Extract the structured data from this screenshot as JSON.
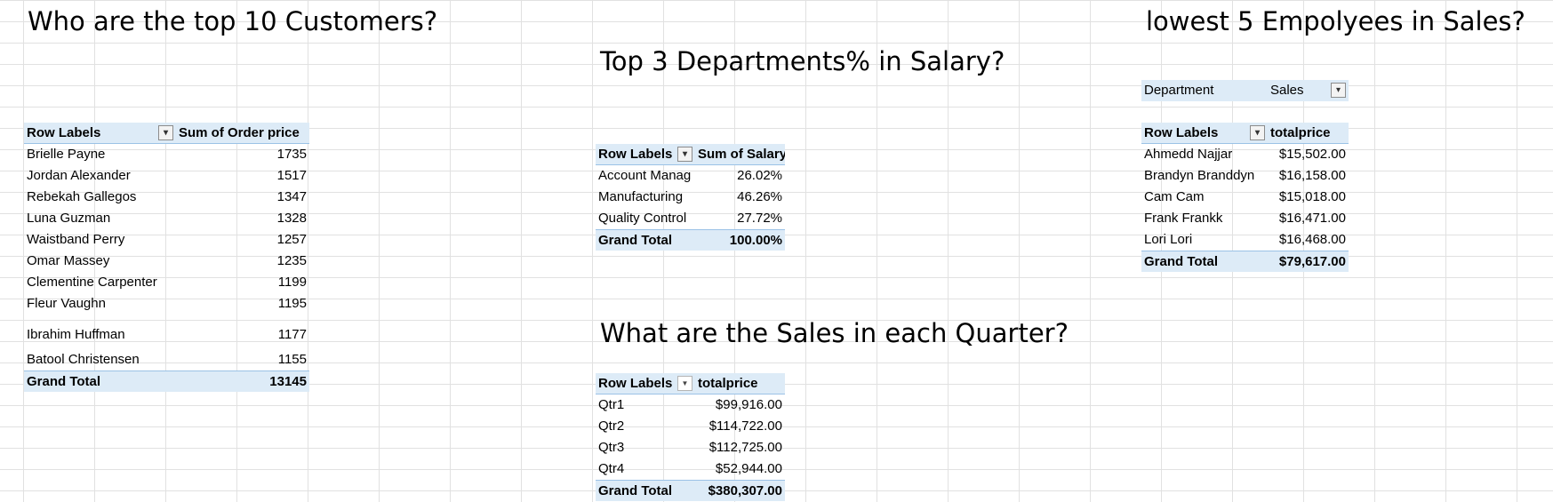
{
  "titles": {
    "top_customers": "Who are the top 10 Customers?",
    "top_departments": "Top 3 Departments% in Salary?",
    "lowest_employees": "lowest 5 Empolyees in Sales?",
    "quarter_sales": "What are the Sales in each Quarter?"
  },
  "customers_pivot": {
    "headers": [
      "Row Labels",
      "Sum of Order price"
    ],
    "rows": [
      {
        "label": "Brielle Payne",
        "value": "1735"
      },
      {
        "label": "Jordan Alexander",
        "value": "1517"
      },
      {
        "label": "Rebekah Gallegos",
        "value": "1347"
      },
      {
        "label": "Luna Guzman",
        "value": "1328"
      },
      {
        "label": "Waistband Perry",
        "value": "1257"
      },
      {
        "label": "Omar Massey",
        "value": "1235"
      },
      {
        "label": "Clementine Carpenter",
        "value": "1199"
      },
      {
        "label": "Fleur Vaughn",
        "value": "1195"
      },
      {
        "label": "Ibrahim Huffman",
        "value": "1177"
      },
      {
        "label": "Batool Christensen",
        "value": "1155"
      }
    ],
    "total": {
      "label": "Grand Total",
      "value": "13145"
    }
  },
  "departments_pivot": {
    "headers": [
      "Row Labels",
      "Sum of Salary"
    ],
    "rows": [
      {
        "label": "Account Manag",
        "value": "26.02%"
      },
      {
        "label": "Manufacturing",
        "value": "46.26%"
      },
      {
        "label": "Quality Control",
        "value": "27.72%"
      }
    ],
    "total": {
      "label": "Grand Total",
      "value": "100.00%"
    }
  },
  "employees_pivot": {
    "filter": {
      "field": "Department",
      "value": "Sales"
    },
    "headers": [
      "Row Labels",
      "totalprice"
    ],
    "rows": [
      {
        "label": "Ahmedd Najjar",
        "value": "$15,502.00"
      },
      {
        "label": "Brandyn Branddyn",
        "value": "$16,158.00"
      },
      {
        "label": "Cam Cam",
        "value": "$15,018.00"
      },
      {
        "label": "Frank Frankk",
        "value": "$16,471.00"
      },
      {
        "label": "Lori Lori",
        "value": "$16,468.00"
      }
    ],
    "total": {
      "label": "Grand Total",
      "value": "$79,617.00"
    }
  },
  "quarters_pivot": {
    "headers": [
      "Row Labels",
      "totalprice"
    ],
    "rows": [
      {
        "label": "Qtr1",
        "value": "$99,916.00"
      },
      {
        "label": "Qtr2",
        "value": "$114,722.00"
      },
      {
        "label": "Qtr3",
        "value": "$112,725.00"
      },
      {
        "label": "Qtr4",
        "value": "$52,944.00"
      }
    ],
    "total": {
      "label": "Grand Total",
      "value": "$380,307.00"
    }
  },
  "icons": {
    "filter": "funnel-icon",
    "dropdown": "chevron-down-icon"
  },
  "colors": {
    "pivot_header_bg": "#ddebf7",
    "pivot_border": "#9bc2e6",
    "gridline": "#e1e1e1"
  }
}
